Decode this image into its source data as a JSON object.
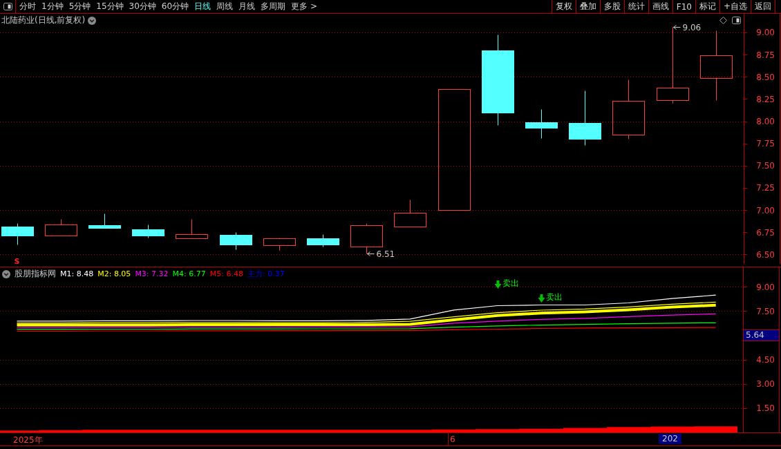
{
  "toolbar": {
    "tabs": [
      {
        "label": "分时",
        "selected": false
      },
      {
        "label": "1分钟",
        "selected": false
      },
      {
        "label": "5分钟",
        "selected": false
      },
      {
        "label": "15分钟",
        "selected": false
      },
      {
        "label": "30分钟",
        "selected": false
      },
      {
        "label": "60分钟",
        "selected": false
      },
      {
        "label": "日线",
        "selected": true
      },
      {
        "label": "周线",
        "selected": false
      },
      {
        "label": "月线",
        "selected": false
      },
      {
        "label": "多周期",
        "selected": false
      },
      {
        "label": "更多 >",
        "selected": false
      }
    ],
    "buttons": [
      "复权",
      "叠加",
      "多股",
      "统计",
      "画线",
      "F10",
      "标记",
      "+自选",
      "返回"
    ]
  },
  "main_chart": {
    "title": "北陆药业(日线,前复权)",
    "price_axis": [
      "9.00",
      "8.75",
      "8.50",
      "8.25",
      "8.00",
      "7.75",
      "7.50",
      "7.25",
      "7.00",
      "6.75",
      "6.50"
    ],
    "price_marks": [
      "6.51",
      "9.06"
    ],
    "signal": "S"
  },
  "indicator": {
    "name": "股朋指标网",
    "legend": [
      {
        "text": "M1: 8.48",
        "color": "#ffffff"
      },
      {
        "text": "M2: 8.05",
        "color": "#ffff00"
      },
      {
        "text": "M3: 7.32",
        "color": "#ff00ff"
      },
      {
        "text": "M4: 6.77",
        "color": "#00ff00"
      },
      {
        "text": "M5: 6.48",
        "color": "#ff0000"
      },
      {
        "text": "主力: 0.37",
        "color": "#0000ff"
      }
    ],
    "chart_data": {
      "type": "line",
      "ylim": [
        0,
        10.24
      ],
      "yticks": [
        {
          "value": 9,
          "label": "9.00"
        },
        {
          "value": 7.5,
          "label": "7.50"
        },
        {
          "value": 4.5,
          "label": "4.50"
        },
        {
          "value": 3,
          "label": "3.00"
        },
        {
          "value": 1.5,
          "label": "1.50"
        }
      ],
      "grid": true,
      "series": [
        {
          "color": "#ffff00",
          "values": [
            6.63,
            6.63,
            6.64,
            6.64,
            6.65,
            6.65,
            6.65,
            6.65,
            6.66,
            6.68,
            6.95,
            7.22,
            7.37,
            7.45,
            7.57,
            7.74,
            7.86
          ]
        },
        {
          "color": "#ffffff",
          "values": [
            6.88,
            6.88,
            6.9,
            6.9,
            6.91,
            6.91,
            6.9,
            6.9,
            6.92,
            7.0,
            7.56,
            7.83,
            7.87,
            7.87,
            8.0,
            8.27,
            8.48
          ]
        },
        {
          "color": "#ffff00",
          "values": [
            6.76,
            6.76,
            6.78,
            6.78,
            6.79,
            6.79,
            6.78,
            6.78,
            6.8,
            6.86,
            7.14,
            7.4,
            7.55,
            7.62,
            7.75,
            7.92,
            8.05
          ]
        },
        {
          "color": "#ff00ff",
          "values": [
            6.48,
            6.48,
            6.49,
            6.49,
            6.5,
            6.5,
            6.5,
            6.51,
            6.51,
            6.52,
            6.75,
            6.88,
            6.98,
            7.05,
            7.15,
            7.25,
            7.32
          ]
        },
        {
          "color": "#00ff00",
          "values": [
            6.37,
            6.37,
            6.38,
            6.38,
            6.39,
            6.39,
            6.39,
            6.4,
            6.4,
            6.41,
            6.5,
            6.58,
            6.63,
            6.67,
            6.71,
            6.75,
            6.77
          ]
        },
        {
          "color": "#ff0000",
          "values": [
            6.26,
            6.26,
            6.27,
            6.27,
            6.28,
            6.28,
            6.29,
            6.29,
            6.3,
            6.3,
            6.34,
            6.38,
            6.42,
            6.45,
            6.46,
            6.47,
            6.48
          ]
        }
      ],
      "annotations": [
        "卖出",
        "卖出"
      ]
    }
  },
  "date_axis": [
    "2025年",
    "6"
  ],
  "cursor": {
    "value_label": "5.64",
    "date_label": "202"
  }
}
